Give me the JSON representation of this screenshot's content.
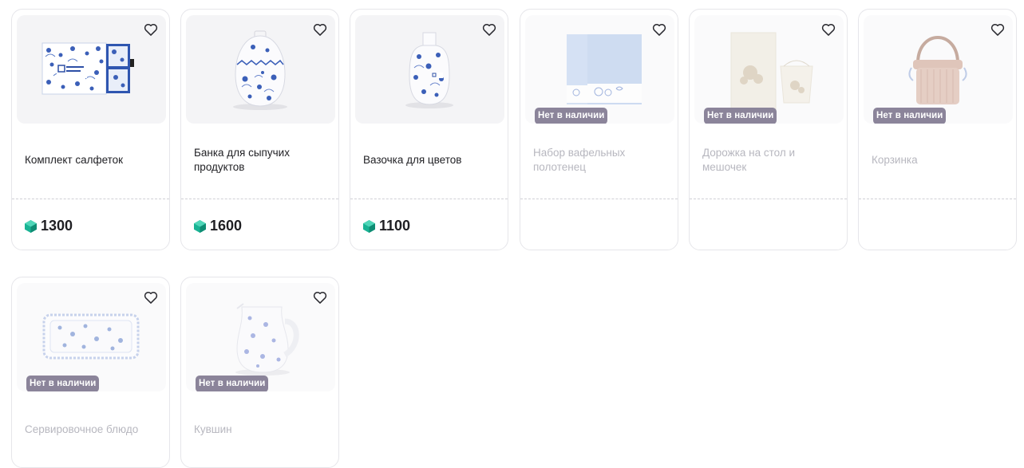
{
  "colors": {
    "badge_bg": "#8b849a",
    "gem": "#19b394",
    "text_muted": "#b7b7bf",
    "heart_stroke": "#2a2a30"
  },
  "labels": {
    "out_of_stock": "Нет в наличии",
    "currency_icon": "gem-icon",
    "favorite_icon": "heart-icon"
  },
  "products": [
    {
      "title": "Комплект салфеток",
      "price": "1300",
      "available": true,
      "image": "napkin-set-image"
    },
    {
      "title": "Банка для сыпучих продуктов",
      "price": "1600",
      "available": true,
      "image": "jar-image"
    },
    {
      "title": "Вазочка для цветов",
      "price": "1100",
      "available": true,
      "image": "vase-image"
    },
    {
      "title": "Набор вафельных полотенец",
      "price": "",
      "available": false,
      "image": "towel-set-image"
    },
    {
      "title": "Дорожка на стол и мешочек",
      "price": "",
      "available": false,
      "image": "table-runner-image"
    },
    {
      "title": "Корзинка",
      "price": "",
      "available": false,
      "image": "basket-image"
    },
    {
      "title": "Сервировочное блюдо",
      "price": "",
      "available": false,
      "image": "serving-dish-image"
    },
    {
      "title": "Кувшин",
      "price": "",
      "available": false,
      "image": "jug-image"
    }
  ]
}
